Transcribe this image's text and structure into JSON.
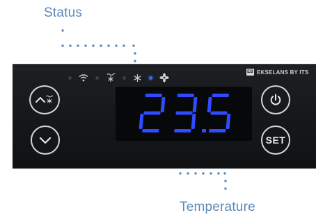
{
  "callouts": {
    "status": "Status",
    "temperature": "Temperature"
  },
  "colors": {
    "callout_text": "#5b88b7",
    "display_blue": "#2e4bff",
    "led_active": "#2f6fe8",
    "panel": "#17191c"
  },
  "controller": {
    "brand": "EKSELANS BY ITS",
    "brand_logo": "EB",
    "display_value": "23.5",
    "indicators": [
      {
        "name": "led-dot-icon",
        "active": false
      },
      {
        "name": "wifi-icon",
        "active": false
      },
      {
        "name": "led-dot-icon",
        "active": false
      },
      {
        "name": "defrost-icon",
        "active": false
      },
      {
        "name": "led-dot-icon",
        "active": false
      },
      {
        "name": "snowflake-icon",
        "active": false
      },
      {
        "name": "led-dot-icon",
        "active": true
      },
      {
        "name": "fan-icon",
        "active": false
      }
    ],
    "buttons": {
      "up": "up-defrost-icon",
      "down": "chevron-down-icon",
      "power": "power-icon",
      "set_label": "SET"
    }
  }
}
